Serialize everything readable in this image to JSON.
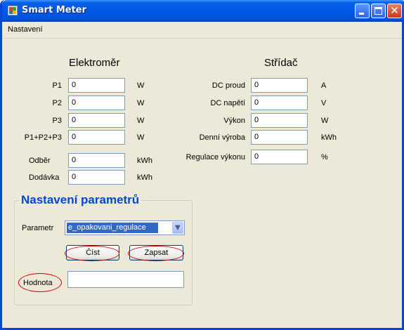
{
  "window": {
    "title": "Smart Meter"
  },
  "menu": {
    "items": [
      "Nastavení"
    ]
  },
  "elektromer": {
    "title": "Elektroměr",
    "rows": [
      {
        "label": "P1",
        "value": "0",
        "unit": "W"
      },
      {
        "label": "P2",
        "value": "0",
        "unit": "W"
      },
      {
        "label": "P3",
        "value": "0",
        "unit": "W"
      },
      {
        "label": "P1+P2+P3",
        "value": "0",
        "unit": "W"
      },
      {
        "label": "Odběr",
        "value": "0",
        "unit": "kWh"
      },
      {
        "label": "Dodávka",
        "value": "0",
        "unit": "kWh"
      }
    ]
  },
  "stridac": {
    "title": "Střídač",
    "rows": [
      {
        "label": "DC proud",
        "value": "0",
        "unit": "A"
      },
      {
        "label": "DC napětí",
        "value": "0",
        "unit": "V"
      },
      {
        "label": "Výkon",
        "value": "0",
        "unit": "W"
      },
      {
        "label": "Denní výroba",
        "value": "0",
        "unit": "kWh"
      },
      {
        "label": "Regulace výkonu",
        "value": "0",
        "unit": "%"
      }
    ]
  },
  "params": {
    "title": "Nastavení parametrů",
    "param_label": "Parametr",
    "param_selected": "e_opakovani_regulace",
    "read_button": "Číst",
    "write_button": "Zapsat",
    "value_label": "Hodnota",
    "value_input": ""
  },
  "colors": {
    "titlebar": "#0058e8",
    "group_title": "#0046d5",
    "annotation": "#cc0000",
    "window_bg": "#ece9d8"
  }
}
